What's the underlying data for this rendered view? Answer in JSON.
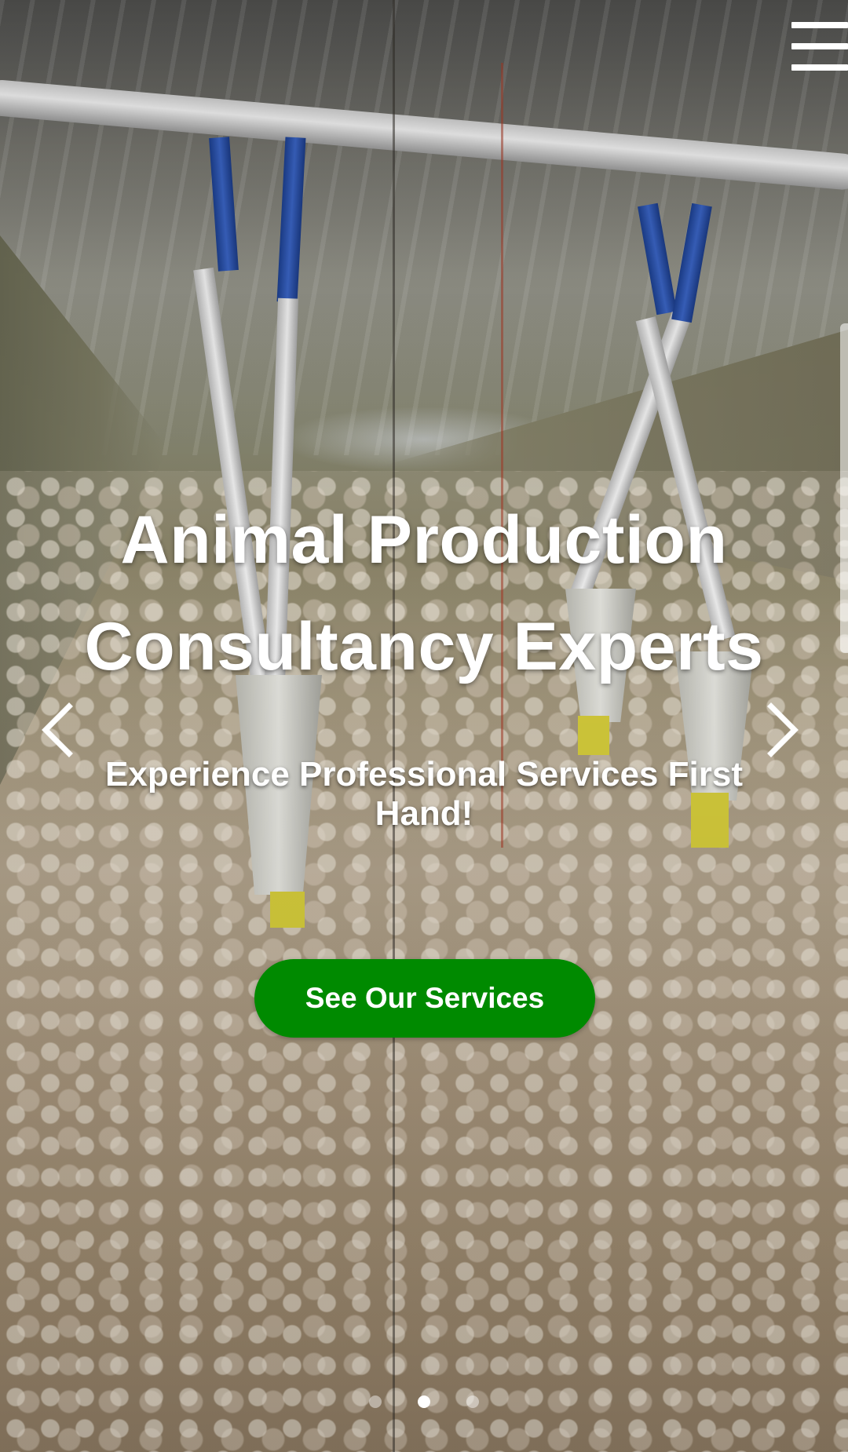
{
  "hero": {
    "title_line1": "Animal Production",
    "title_line2": "Consultancy Experts",
    "subtitle": "Experience Professional Services First Hand!",
    "cta_label": "See Our Services",
    "cta_color": "#008a00",
    "text_color": "#ffffff"
  },
  "carousel": {
    "prev_icon": "chevron-left-icon",
    "next_icon": "chevron-right-icon",
    "slide_count": 3,
    "active_slide": 2
  },
  "nav": {
    "menu_icon": "hamburger-menu-icon"
  }
}
